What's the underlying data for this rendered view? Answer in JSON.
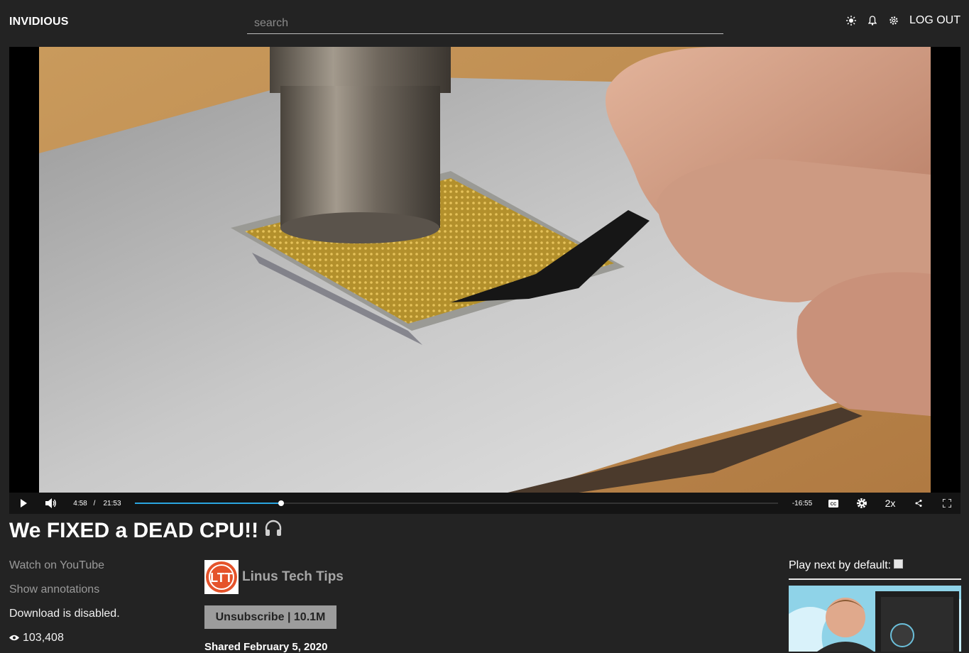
{
  "header": {
    "brand": "INVIDIOUS",
    "search_placeholder": "search",
    "theme_icon": "sun-icon",
    "notifications_icon": "bell-icon",
    "settings_icon": "gear-icon",
    "logout_label": "LOG OUT"
  },
  "player": {
    "current_time": "4:58",
    "separator": "/",
    "duration": "21:53",
    "remaining": "-16:55",
    "speed": "2x",
    "progress_fraction": 0.227,
    "icons": [
      "play-icon",
      "volume-icon",
      "captions-icon",
      "settings-icon",
      "share-icon",
      "fullscreen-icon"
    ],
    "accent_color": "#2ba5e0"
  },
  "video": {
    "title": "We FIXED a DEAD CPU!!",
    "audio_icon": "headphones-icon"
  },
  "left_links": {
    "watch_on_youtube": "Watch on YouTube",
    "show_annotations": "Show annotations",
    "download_status": "Download is disabled.",
    "views": "103,408",
    "views_icon": "eye-icon"
  },
  "channel": {
    "name": "Linus Tech Tips",
    "avatar_text": "LTT",
    "subscribe_label": "Unsubscribe | 10.1M",
    "shared": "Shared February 5, 2020"
  },
  "sidebar": {
    "play_next_label": "Play next by default:",
    "play_next_checked": false
  }
}
